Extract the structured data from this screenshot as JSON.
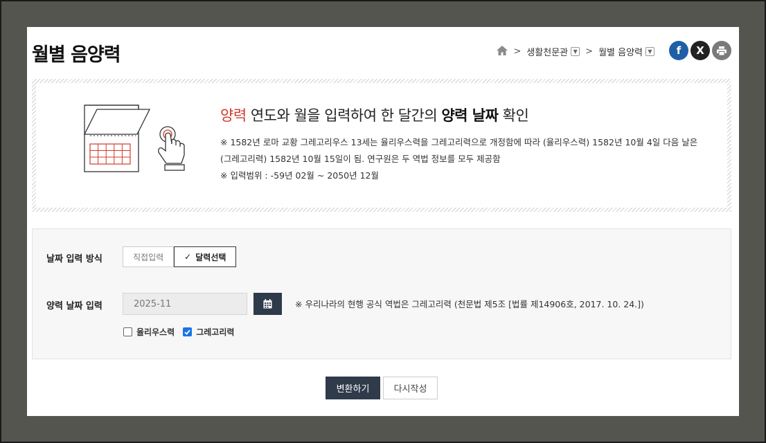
{
  "page": {
    "title": "월별 음양력"
  },
  "breadcrumb": {
    "items": [
      "생활천문관",
      "월별 음양력"
    ]
  },
  "share": {
    "facebook_glyph": "f",
    "x_glyph": "X"
  },
  "banner": {
    "heading_accent": "양력",
    "heading_mid": " 연도와 월을 입력하여 한 달간의 ",
    "heading_bold": "양력 날짜",
    "heading_end": " 확인",
    "note_1": "※ 1582년 로마 교황 그레고리우스 13세는 율리우스력을 그레고리력으로 개정함에 따라 (율리우스력) 1582년 10월 4일 다음 날은 (그레고리력) 1582년 10월 15일이 됨. 연구원은 두 역법 정보를 모두 제공함",
    "note_2": "※ 입력범위 : -59년 02월 ~ 2050년 12월"
  },
  "form": {
    "input_method_label": "날짜 입력 방식",
    "method_direct": "직접입력",
    "method_calendar": "달력선택",
    "method_selected": "달력선택",
    "date_label": "양력 날짜 입력",
    "date_value": "2025-11",
    "hint": "※ 우리나라의 현행 공식 역법은 그레고리력 (천문법 제5조 [법률 제14906호, 2017. 10. 24.])",
    "julian_label": "율리우스력",
    "julian_checked": false,
    "gregorian_label": "그레고리력",
    "gregorian_checked": true
  },
  "actions": {
    "convert": "변환하기",
    "reset": "다시작성"
  },
  "colors": {
    "accent_red": "#d0392b",
    "primary_dark": "#2f3a4a",
    "checkbox_blue": "#1a73e8"
  }
}
